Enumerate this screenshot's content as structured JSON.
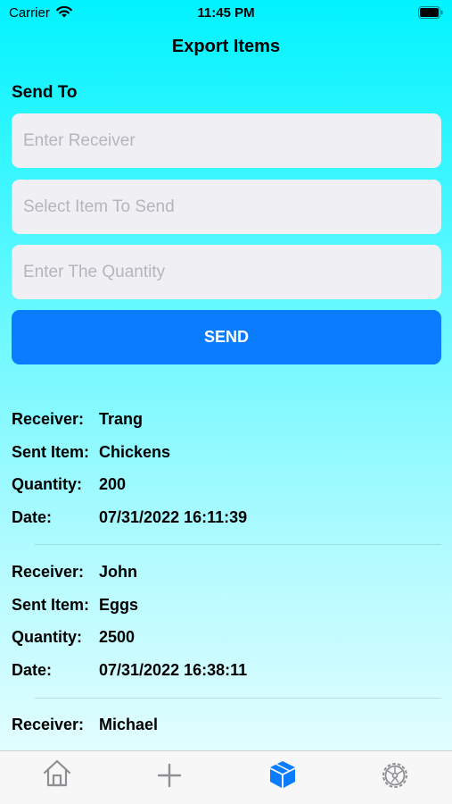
{
  "status_bar": {
    "carrier": "Carrier",
    "time": "11:45 PM"
  },
  "nav": {
    "title": "Export Items"
  },
  "form": {
    "section_title": "Send To",
    "receiver_placeholder": "Enter Receiver",
    "item_placeholder": "Select Item To Send",
    "quantity_placeholder": "Enter The Quantity",
    "send_label": "SEND"
  },
  "labels": {
    "receiver": "Receiver:",
    "sent_item": "Sent Item:",
    "quantity": "Quantity:",
    "date": "Date:"
  },
  "records": [
    {
      "receiver": "Trang",
      "item": "Chickens",
      "quantity": "200",
      "date": "07/31/2022 16:11:39"
    },
    {
      "receiver": "John",
      "item": "Eggs",
      "quantity": "2500",
      "date": "07/31/2022 16:38:11"
    },
    {
      "receiver": "Michael"
    }
  ],
  "tab_bar": {
    "tabs": [
      {
        "icon": "house-icon",
        "active": false
      },
      {
        "icon": "plus-icon",
        "active": false
      },
      {
        "icon": "cube-icon",
        "active": true
      },
      {
        "icon": "gear-icon",
        "active": false
      }
    ],
    "active_color": "#0a7cff",
    "inactive_color": "#8e8e93"
  },
  "colors": {
    "accent": "#0a7cff",
    "field_bg": "#efeff4"
  }
}
